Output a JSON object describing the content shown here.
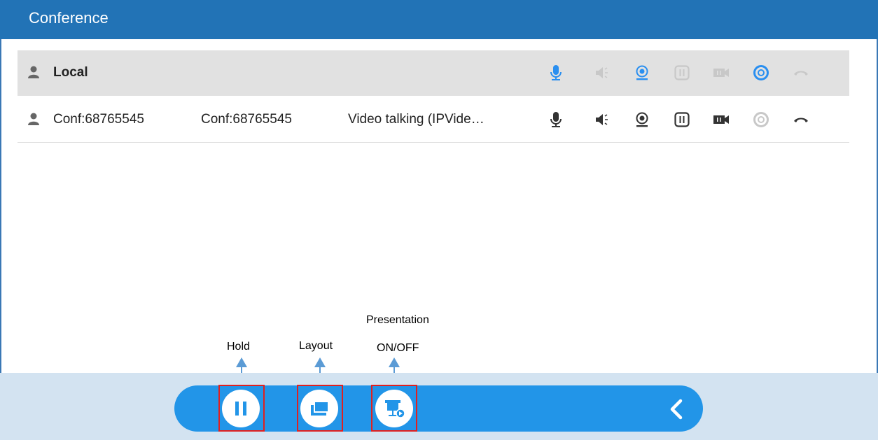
{
  "header": {
    "title": "Conference"
  },
  "participants": [
    {
      "name": "Local",
      "number": "",
      "status": "",
      "icons": [
        "mic-icon",
        "speaker-icon",
        "camera-icon",
        "hold-icon",
        "video-icon",
        "presentation-icon",
        "hangup-icon"
      ],
      "icon_colors": {
        "mic": "#2a8ff0",
        "speaker": "#c8c8c8",
        "camera": "#2a8ff0",
        "hold": "#c8c8c8",
        "video": "#c8c8c8",
        "presentation": "#2a8ff0",
        "hangup": "#c8c8c8"
      }
    },
    {
      "name": "Conf:68765545",
      "number": "Conf:68765545",
      "status": "Video talking (IPVide…",
      "icons": [
        "mic-icon",
        "speaker-icon",
        "camera-icon",
        "hold-icon",
        "video-icon",
        "presentation-icon",
        "hangup-icon"
      ],
      "icon_colors": {
        "mic": "#333333",
        "speaker": "#333333",
        "camera": "#333333",
        "hold": "#333333",
        "video": "#333333",
        "presentation": "#c8c8c8",
        "hangup": "#333333"
      }
    }
  ],
  "annotations": {
    "hold": "Hold",
    "layout": "Layout",
    "presentation_line1": "Presentation",
    "presentation_line2": "ON/OFF"
  },
  "controls": {
    "buttons": [
      "hold-button",
      "layout-button",
      "presentation-button"
    ],
    "back": "back-chevron-icon"
  },
  "colors": {
    "header": "#2273b6",
    "pill": "#2295e8",
    "highlight": "#e02020",
    "arrow": "#5b9bd5"
  }
}
